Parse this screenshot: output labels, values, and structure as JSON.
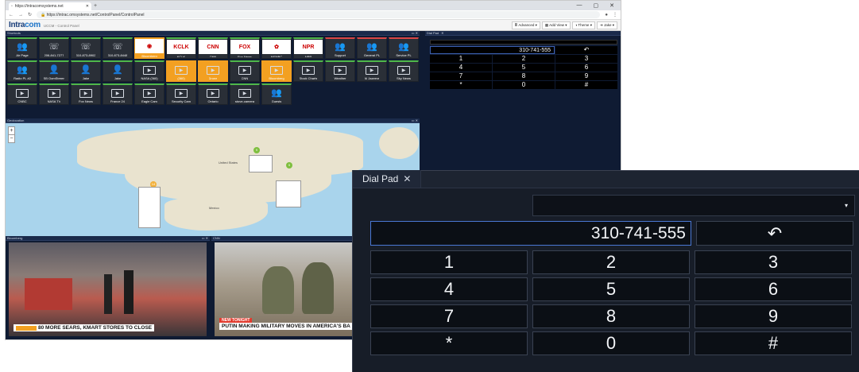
{
  "browser": {
    "tab_title": "https://intracomsystems.net",
    "url": "https://intrac.omsystems.net/ControlPanel/ControlPanel",
    "window_controls": [
      "—",
      "▢",
      "✕"
    ]
  },
  "app": {
    "logo_prefix": "Intra",
    "logo_suffix": "com",
    "subtitle": "UCCM - Control Panel",
    "menu": [
      "≣ Advanced ▾",
      "▦ Add View ▾",
      "◑ Theme ▾",
      "➔ Jake ▾"
    ]
  },
  "panels": {
    "shortcuts": "Shortcuts",
    "geolocation": "Geolocation",
    "video1": "Bloomberg",
    "video2": "CNN",
    "small_dialpad": "Dial Pad"
  },
  "shortcuts": [
    {
      "label": "Air Page",
      "icon": "group-icon",
      "style": "green"
    },
    {
      "label": "206-841-7277",
      "icon": "phone-icon",
      "style": "green"
    },
    {
      "label": "310-873-8902",
      "icon": "phone-icon",
      "style": "green"
    },
    {
      "label": "310-873-8448",
      "icon": "phone-icon",
      "style": "green"
    },
    {
      "label": "Bloomberg",
      "icon": "bloomberg-logo",
      "style": "orange"
    },
    {
      "label": "KCLK",
      "icon": "kclk-logo",
      "style": "green"
    },
    {
      "label": "CNN",
      "icon": "cnn-logo",
      "style": "green"
    },
    {
      "label": "Fox News",
      "icon": "foxnews-logo",
      "style": "green"
    },
    {
      "label": "MSNBC",
      "icon": "msnbc-logo",
      "style": "green"
    },
    {
      "label": "NPR",
      "icon": "npr-logo",
      "style": "green"
    },
    {
      "label": "Support",
      "icon": "group-icon",
      "style": "red"
    },
    {
      "label": "General PL",
      "icon": "group-icon",
      "style": "red"
    },
    {
      "label": "Service PL",
      "icon": "group-icon",
      "style": "red"
    },
    {
      "label": "Radio PL #2",
      "icon": "group-icon",
      "style": "green"
    },
    {
      "label": "SB OomStreen",
      "icon": "person-icon",
      "style": "green"
    },
    {
      "label": "Jake",
      "icon": "person-icon",
      "style": "green"
    },
    {
      "label": "Jake",
      "icon": "person-icon",
      "style": "green"
    },
    {
      "label": "NASA (360)",
      "icon": "video-icon",
      "style": "green"
    },
    {
      "label": "(360)",
      "icon": "video-icon",
      "style": "orange"
    },
    {
      "label": "Drone",
      "icon": "video-icon",
      "style": "orange"
    },
    {
      "label": "CNN",
      "icon": "video-icon",
      "style": "green"
    },
    {
      "label": "Bloomberg",
      "icon": "video-icon",
      "style": "orange"
    },
    {
      "label": "Stock Charts",
      "icon": "video-icon",
      "style": "green"
    },
    {
      "label": "Weather",
      "icon": "video-icon",
      "style": "green"
    },
    {
      "label": "Al Jazeera",
      "icon": "video-icon",
      "style": "green"
    },
    {
      "label": "Sky News",
      "icon": "video-icon",
      "style": "green"
    },
    {
      "label": "CNBC",
      "icon": "video-icon",
      "style": "green"
    },
    {
      "label": "NASA TV",
      "icon": "video-icon",
      "style": "green"
    },
    {
      "label": "Fox News",
      "icon": "video-icon",
      "style": "green"
    },
    {
      "label": "France 24",
      "icon": "video-icon",
      "style": "green"
    },
    {
      "label": "Eagle Cam",
      "icon": "video-icon",
      "style": "green"
    },
    {
      "label": "Security Cam",
      "icon": "video-icon",
      "style": "green"
    },
    {
      "label": "Ontario",
      "icon": "video-icon",
      "style": "green"
    },
    {
      "label": "stove-camera",
      "icon": "video-icon",
      "style": "green"
    },
    {
      "label": "Guests",
      "icon": "group-icon",
      "style": "green"
    }
  ],
  "map": {
    "zoom_in": "+",
    "zoom_out": "−",
    "labels": [
      "United States",
      "Mexico"
    ],
    "markers": [
      "9",
      "14",
      "5"
    ]
  },
  "video1": {
    "ticker": "80 MORE SEARS, KMART STORES TO CLOSE"
  },
  "video2": {
    "tag": "NEW TONIGHT",
    "ticker": "PUTIN MAKING MILITARY MOVES IN AMERICA'S BA"
  },
  "dialpad": {
    "tab": "Dial Pad",
    "close": "✕",
    "dropdown_arrow": "▾",
    "number": "310-741-555",
    "backspace": "↶",
    "keys": [
      [
        "1",
        "2",
        "3"
      ],
      [
        "4",
        "5",
        "6"
      ],
      [
        "7",
        "8",
        "9"
      ],
      [
        "*",
        "0",
        "#"
      ]
    ]
  }
}
